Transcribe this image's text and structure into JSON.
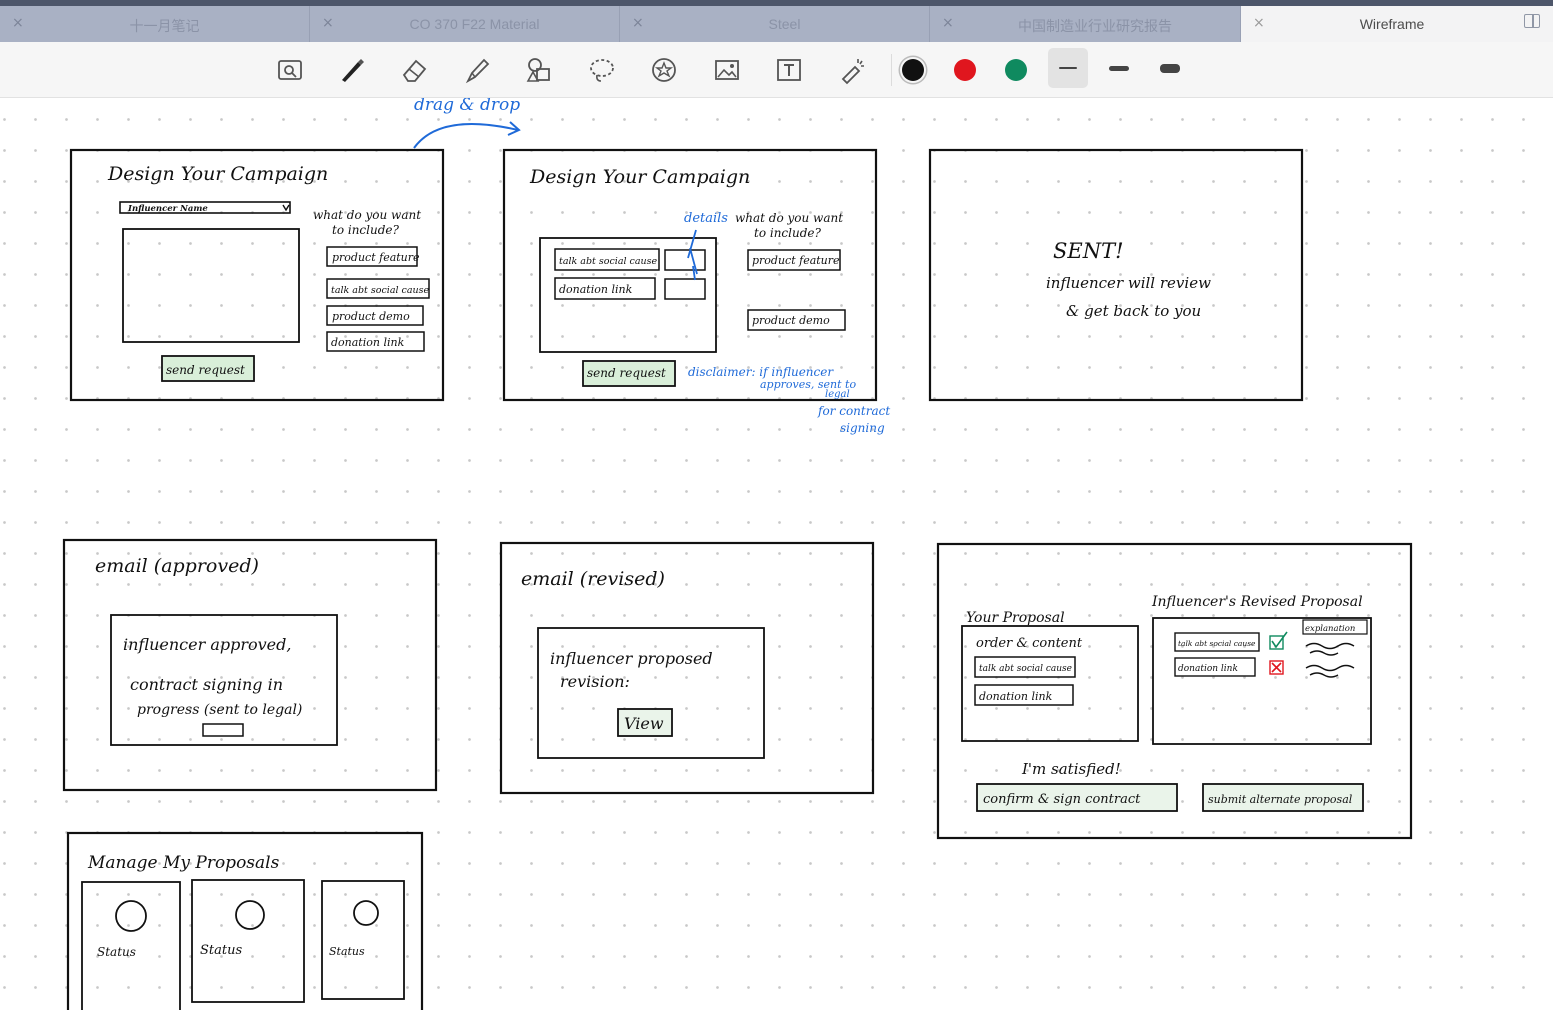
{
  "tabs": [
    {
      "label": "十一月笔记",
      "active": false
    },
    {
      "label": "CO 370 F22 Material",
      "active": false
    },
    {
      "label": "Steel",
      "active": false
    },
    {
      "label": "中国制造业行业研究报告",
      "active": false
    },
    {
      "label": "Wireframe",
      "active": true
    }
  ],
  "tab_close_glyph": "×",
  "toolbar": {
    "tools": [
      "zoom-view-icon",
      "pen-icon",
      "eraser-icon",
      "highlighter-icon",
      "shapes-icon",
      "lasso-icon",
      "sticker-icon",
      "image-icon",
      "text-box-icon",
      "laser-pointer-icon"
    ],
    "colors": [
      "#111111",
      "#e0161e",
      "#0f8a5f"
    ],
    "stroke_widths": [
      "thin",
      "medium",
      "thick"
    ],
    "selected_stroke": "thin"
  },
  "sketch": {
    "annotation_drag": "drag & drop",
    "frame1": {
      "title": "Design Your Campaign",
      "dropdown": "Influencer Name",
      "question_line1": "what do you want",
      "question_line2": "to include?",
      "options": [
        "product feature",
        "talk abt social cause",
        "product demo",
        "donation link"
      ],
      "button": "send request"
    },
    "frame2": {
      "title": "Design Your Campaign",
      "details_note": "details",
      "question_line1": "what do you want",
      "question_line2": "to include?",
      "dropped": [
        "talk abt social cause",
        "donation link"
      ],
      "options": [
        "product feature",
        "product demo"
      ],
      "button": "send request",
      "disclaimer_lines": [
        "disclaimer: if influencer",
        "approves, sent to",
        "legal",
        "for contract",
        "signing"
      ]
    },
    "frame3": {
      "title": "SENT!",
      "line1": "influencer will review",
      "line2": "& get back to you"
    },
    "frame4": {
      "title": "email (approved)",
      "line1": "influencer approved,",
      "line2": "contract signing in",
      "line3": "progress (sent to legal)"
    },
    "frame5": {
      "title": "email (revised)",
      "line1": "influencer proposed",
      "line2": "revision:",
      "button": "View"
    },
    "frame6": {
      "your_proposal": "Your Proposal",
      "revised_proposal": "Influencer's Revised Proposal",
      "order_label": "order & content",
      "proposal_items": [
        "talk abt social cause",
        "donation link"
      ],
      "explanation": "explanation",
      "revised_items": [
        "talk abt social cause",
        "donation link"
      ],
      "satisfied": "I'm satisfied!",
      "confirm_button": "confirm & sign contract",
      "alternate_button": "submit alternate proposal"
    },
    "frame7": {
      "title": "Manage My Proposals",
      "cards": [
        "Status",
        "Status",
        "Status"
      ]
    }
  }
}
